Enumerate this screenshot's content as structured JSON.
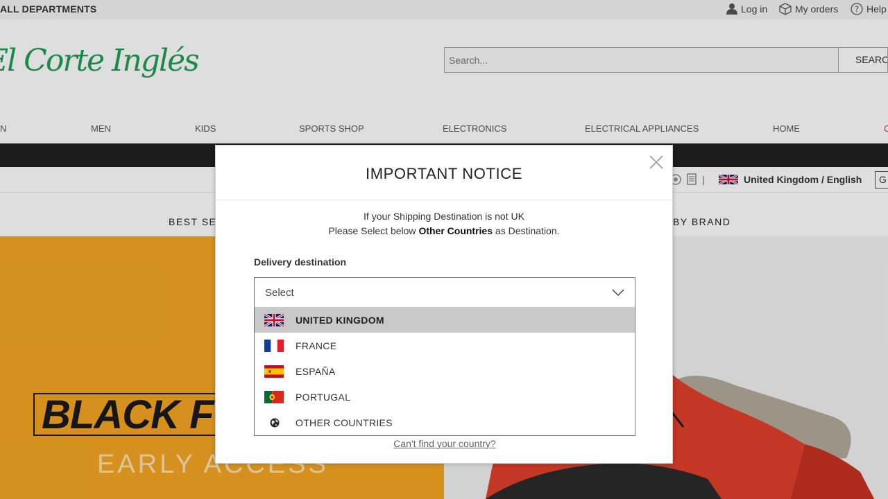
{
  "topbar": {
    "all_departments": "ALL DEPARTMENTS",
    "login": "Log in",
    "my_orders": "My orders",
    "help": "Help"
  },
  "header": {
    "logo_text": "El Corte Inglés",
    "search_placeholder": "Search...",
    "search_button": "SEARCH"
  },
  "main_nav": [
    "N",
    "MEN",
    "KIDS",
    "SPORTS SHOP",
    "ELECTRONICS",
    "ELECTRICAL APPLIANCES",
    "HOME",
    "C"
  ],
  "locale": {
    "label": "United Kingdom / English",
    "lang_box": "G"
  },
  "sub_nav": {
    "left": "BEST SE",
    "right": "BY BRAND"
  },
  "hero": {
    "headline": "BLACK F",
    "subline": "EARLY ACCESS"
  },
  "modal": {
    "title": "IMPORTANT NOTICE",
    "notice_line1": "If your Shipping Destination is not UK",
    "notice_line2_pre": "Please Select below ",
    "notice_line2_bold": "Other Countries",
    "notice_line2_post": " as Destination.",
    "field_label": "Delivery destination",
    "select_value": "Select",
    "options": [
      {
        "label": "UNITED KINGDOM",
        "flag": "uk-flag-icon",
        "selected": true
      },
      {
        "label": "FRANCE",
        "flag": "france-flag-icon",
        "selected": false
      },
      {
        "label": "ESPAÑA",
        "flag": "spain-flag-icon",
        "selected": false
      },
      {
        "label": "PORTUGAL",
        "flag": "portugal-flag-icon",
        "selected": false
      },
      {
        "label": "OTHER COUNTRIES",
        "flag": "globe-icon",
        "selected": false
      }
    ],
    "cant_find": "Can't find your country?"
  },
  "colors": {
    "brand_green": "#1e9f54",
    "hero_orange": "#f5a623",
    "selected_option_bg": "#c9c9c9"
  }
}
